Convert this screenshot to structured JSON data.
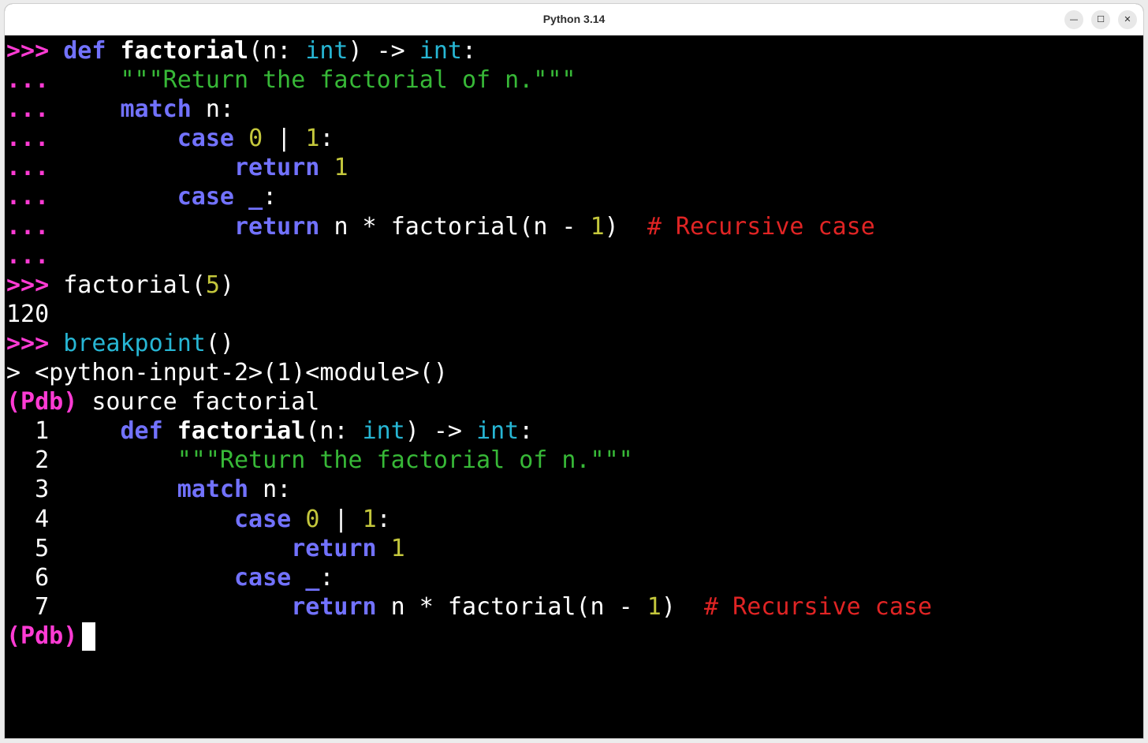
{
  "window": {
    "title": "Python 3.14",
    "minimize_glyph": "—",
    "maximize_glyph": "☐",
    "close_glyph": "✕"
  },
  "prompts": {
    "primary": ">>>",
    "continuation": "...",
    "pdb": "(Pdb)",
    "pdb_location_marker": ">"
  },
  "code": {
    "kw_def": "def",
    "func_name": "factorial",
    "param": "n",
    "type_int": "int",
    "arrow": "->",
    "docstring": "\"\"\"Return the factorial of n.\"\"\"",
    "kw_match": "match",
    "kw_case": "case",
    "num_0": "0",
    "pipe": "|",
    "num_1": "1",
    "kw_return": "return",
    "wildcard": "_",
    "comment": "# Recursive case"
  },
  "session": {
    "call_expr": "factorial(5)",
    "call_arg": "5",
    "result": "120",
    "breakpoint_name": "breakpoint",
    "location": "<python-input-2>(1)<module>()",
    "pdb_command": "source factorial"
  },
  "listing_line_numbers": [
    "1",
    "2",
    "3",
    "4",
    "5",
    "6",
    "7"
  ],
  "colors": {
    "background": "#000000",
    "prompt": "#ff3bd4",
    "keyword": "#7272ff",
    "builtin": "#27b6d4",
    "string": "#37b837",
    "number": "#c4c73c",
    "comment": "#e02424"
  }
}
